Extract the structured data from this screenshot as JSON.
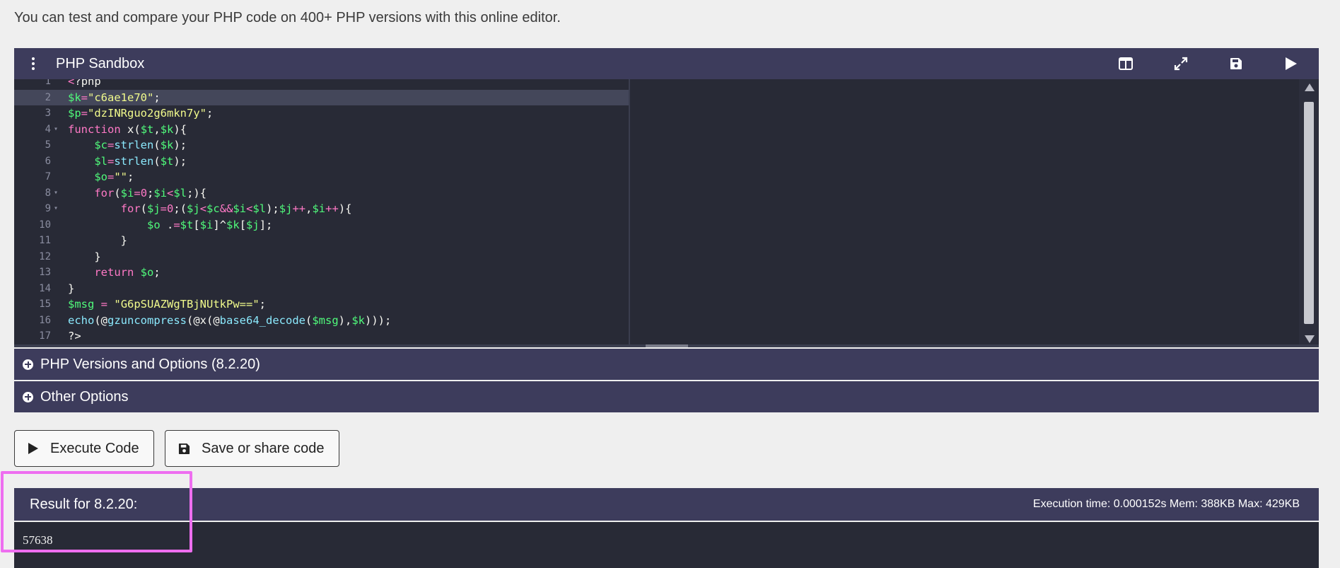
{
  "intro_text": "You can test and compare your PHP code on 400+ PHP versions with this online editor.",
  "sandbox": {
    "title": "PHP Sandbox",
    "toolbar_icons": [
      "split-view-icon",
      "fullscreen-icon",
      "save-icon",
      "run-icon"
    ]
  },
  "editor": {
    "lines": [
      {
        "n": "1",
        "code": "<?php"
      },
      {
        "n": "2",
        "code": "$k=\"c6ae1e70\";"
      },
      {
        "n": "3",
        "code": "$p=\"dzINRguo2g6mkn7y\";"
      },
      {
        "n": "4",
        "code": "function x($t,$k){"
      },
      {
        "n": "5",
        "code": "    $c=strlen($k);"
      },
      {
        "n": "6",
        "code": "    $l=strlen($t);"
      },
      {
        "n": "7",
        "code": "    $o=\"\";"
      },
      {
        "n": "8",
        "code": "    for($i=0;$i<$l;){"
      },
      {
        "n": "9",
        "code": "        for($j=0;($j<$c&&$i<$l);$j++,$i++){"
      },
      {
        "n": "10",
        "code": "            $o .=$t[$i]^$k[$j];"
      },
      {
        "n": "11",
        "code": "        }"
      },
      {
        "n": "12",
        "code": "    }"
      },
      {
        "n": "13",
        "code": "    return $o;"
      },
      {
        "n": "14",
        "code": "}"
      },
      {
        "n": "15",
        "code": "$msg = \"G6pSUAZWgTBjNUtkPw==\";"
      },
      {
        "n": "16",
        "code": "echo(@gzuncompress(@x(@base64_decode($msg),$k)));"
      },
      {
        "n": "17",
        "code": "?>"
      }
    ]
  },
  "accordions": {
    "versions_label": "PHP Versions and Options (8.2.20)",
    "other_label": "Other Options"
  },
  "buttons": {
    "execute_label": "Execute Code",
    "save_label": "Save or share code"
  },
  "result": {
    "title": "Result for 8.2.20:",
    "stats": "Execution time: 0.000152s Mem: 388KB Max: 429KB",
    "output": "57638"
  },
  "colors": {
    "header_bg": "#3d3c5c",
    "editor_bg": "#282a36",
    "highlight_border": "#ee6ef0"
  }
}
